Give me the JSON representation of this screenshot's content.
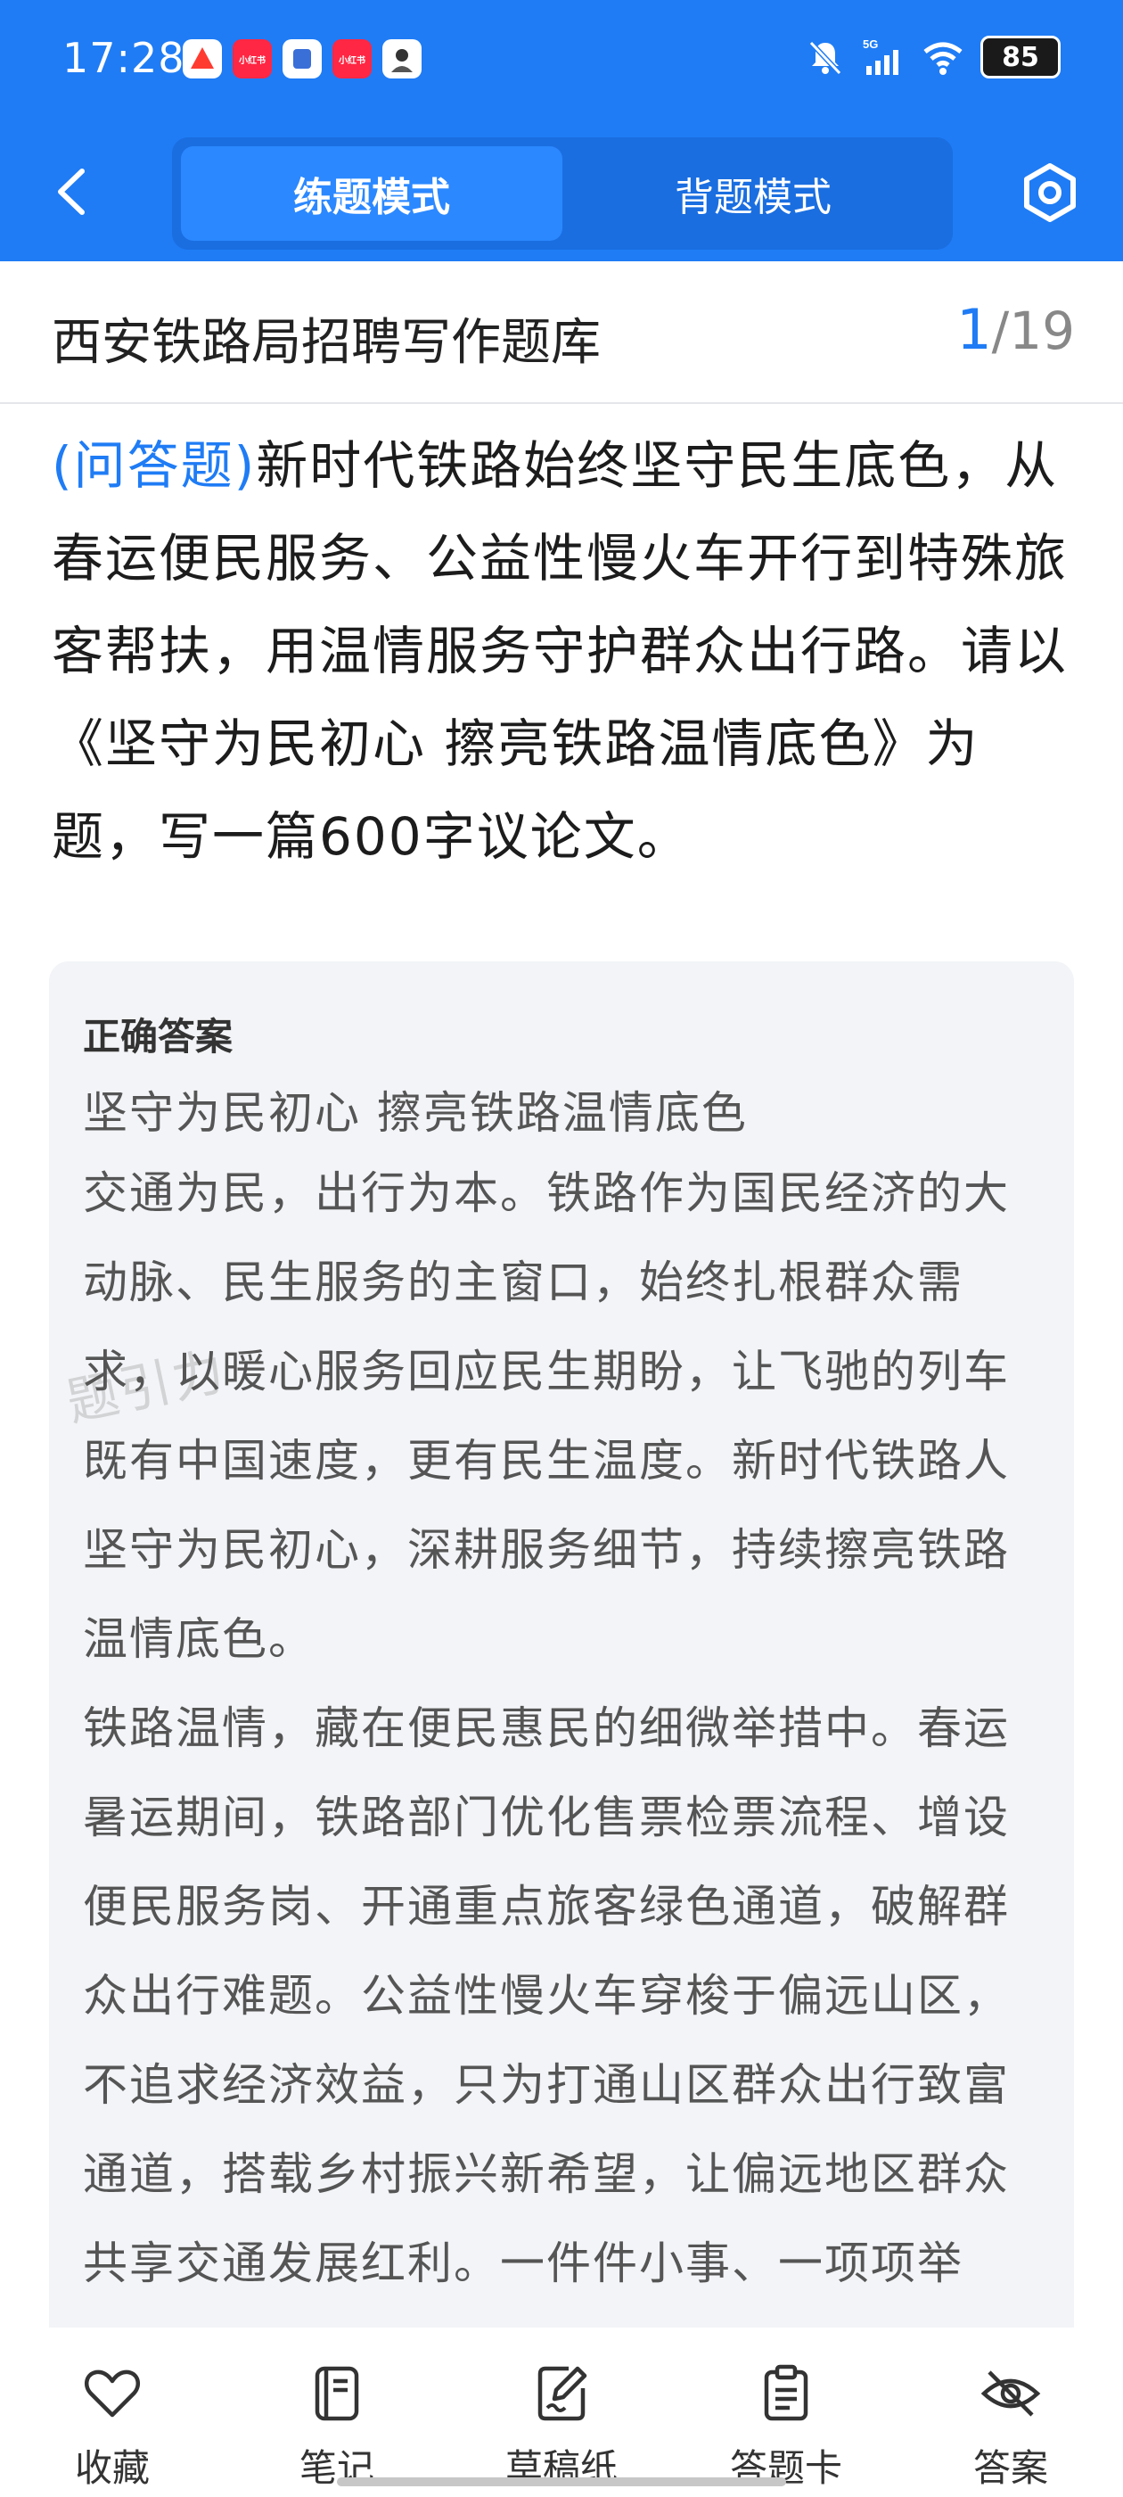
{
  "status_bar": {
    "time": "17:28",
    "notification_icons": [
      "app-icon",
      "xiaohongshu-icon",
      "app-icon",
      "xiaohongshu-icon",
      "avatar-icon"
    ],
    "notification_labels": [
      "",
      "小红书",
      "",
      "小红书",
      ""
    ],
    "network": "5G",
    "battery": "85"
  },
  "nav": {
    "tabs": [
      {
        "label": "练题模式",
        "active": true
      },
      {
        "label": "背题模式",
        "active": false
      }
    ]
  },
  "title_row": {
    "bank_title": "西安铁路局招聘写作题库",
    "current_page": "1",
    "separator": "/",
    "total_pages": "19"
  },
  "question": {
    "type_label": "(问答题)",
    "text": "新时代铁路始终坚守民生底色，从春运便民服务、公益性慢火车开行到特殊旅客帮扶，用温情服务守护群众出行路。请以《坚守为民初心 擦亮铁路温情底色》为题，写一篇600字议论文。"
  },
  "answer": {
    "label": "正确答案",
    "title": "坚守为民初心 擦亮铁路温情底色",
    "paragraphs": [
      "交通为民，出行为本。铁路作为国民经济的大动脉、民生服务的主窗口，始终扎根群众需求，以暖心服务回应民生期盼，让飞驰的列车既有中国速度，更有民生温度。新时代铁路人坚守为民初心，深耕服务细节，持续擦亮铁路温情底色。",
      "铁路温情，藏在便民惠民的细微举措中。春运暑运期间，铁路部门优化售票检票流程、增设便民服务岗、开通重点旅客绿色通道，破解群众出行难题。公益性慢火车穿梭于偏远山区，不追求经济效益，只为打通山区群众出行致富通道，搭载乡村振兴新希望，让偏远地区群众共享交通发展红利。一件件小事、一项项举"
    ],
    "watermark": "题引力"
  },
  "toolbar": {
    "items": [
      {
        "label": "收藏",
        "icon": "heart-icon"
      },
      {
        "label": "笔记",
        "icon": "notebook-icon"
      },
      {
        "label": "草稿纸",
        "icon": "draft-paper-icon"
      },
      {
        "label": "答题卡",
        "icon": "answer-sheet-icon"
      },
      {
        "label": "答案",
        "icon": "eye-hidden-icon"
      }
    ]
  }
}
